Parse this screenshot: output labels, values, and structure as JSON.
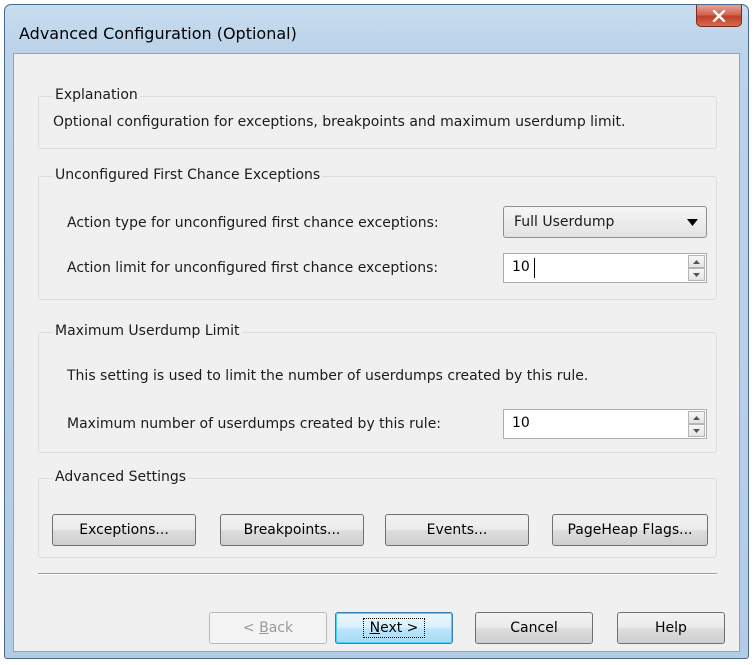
{
  "window": {
    "title": "Advanced Configuration (Optional)"
  },
  "explanation": {
    "group_label": "Explanation",
    "text": "Optional configuration for exceptions, breakpoints and maximum userdump limit."
  },
  "unconfigured": {
    "group_label": "Unconfigured First Chance Exceptions",
    "action_type_label": "Action type for unconfigured first chance exceptions:",
    "action_type_value": "Full Userdump",
    "action_limit_label": "Action limit for unconfigured first chance exceptions:",
    "action_limit_value": "10"
  },
  "max_userdump": {
    "group_label": "Maximum Userdump Limit",
    "description": "This setting is used to limit the number of userdumps created by this rule.",
    "max_label": "Maximum number of userdumps created by this rule:",
    "max_value": "10"
  },
  "advanced": {
    "group_label": "Advanced Settings",
    "exceptions_label": "Exceptions...",
    "breakpoints_label": "Breakpoints...",
    "events_label": "Events...",
    "pageheap_label": "PageHeap Flags..."
  },
  "footer": {
    "back_prefix": "< ",
    "back_mnemonic": "B",
    "back_rest": "ack",
    "next_mnemonic": "N",
    "next_rest": "ext >",
    "cancel_label": "Cancel",
    "help_label": "Help"
  },
  "icons": {
    "close": "close-icon",
    "dropdown": "chevron-down-icon",
    "spin_up": "spin-up-icon",
    "spin_down": "spin-down-icon"
  },
  "colors": {
    "titlebar": "#bcd3ea",
    "client_bg": "#f0f0f0",
    "close_button": "#c0402a",
    "default_button_border": "#3c7fb1"
  }
}
